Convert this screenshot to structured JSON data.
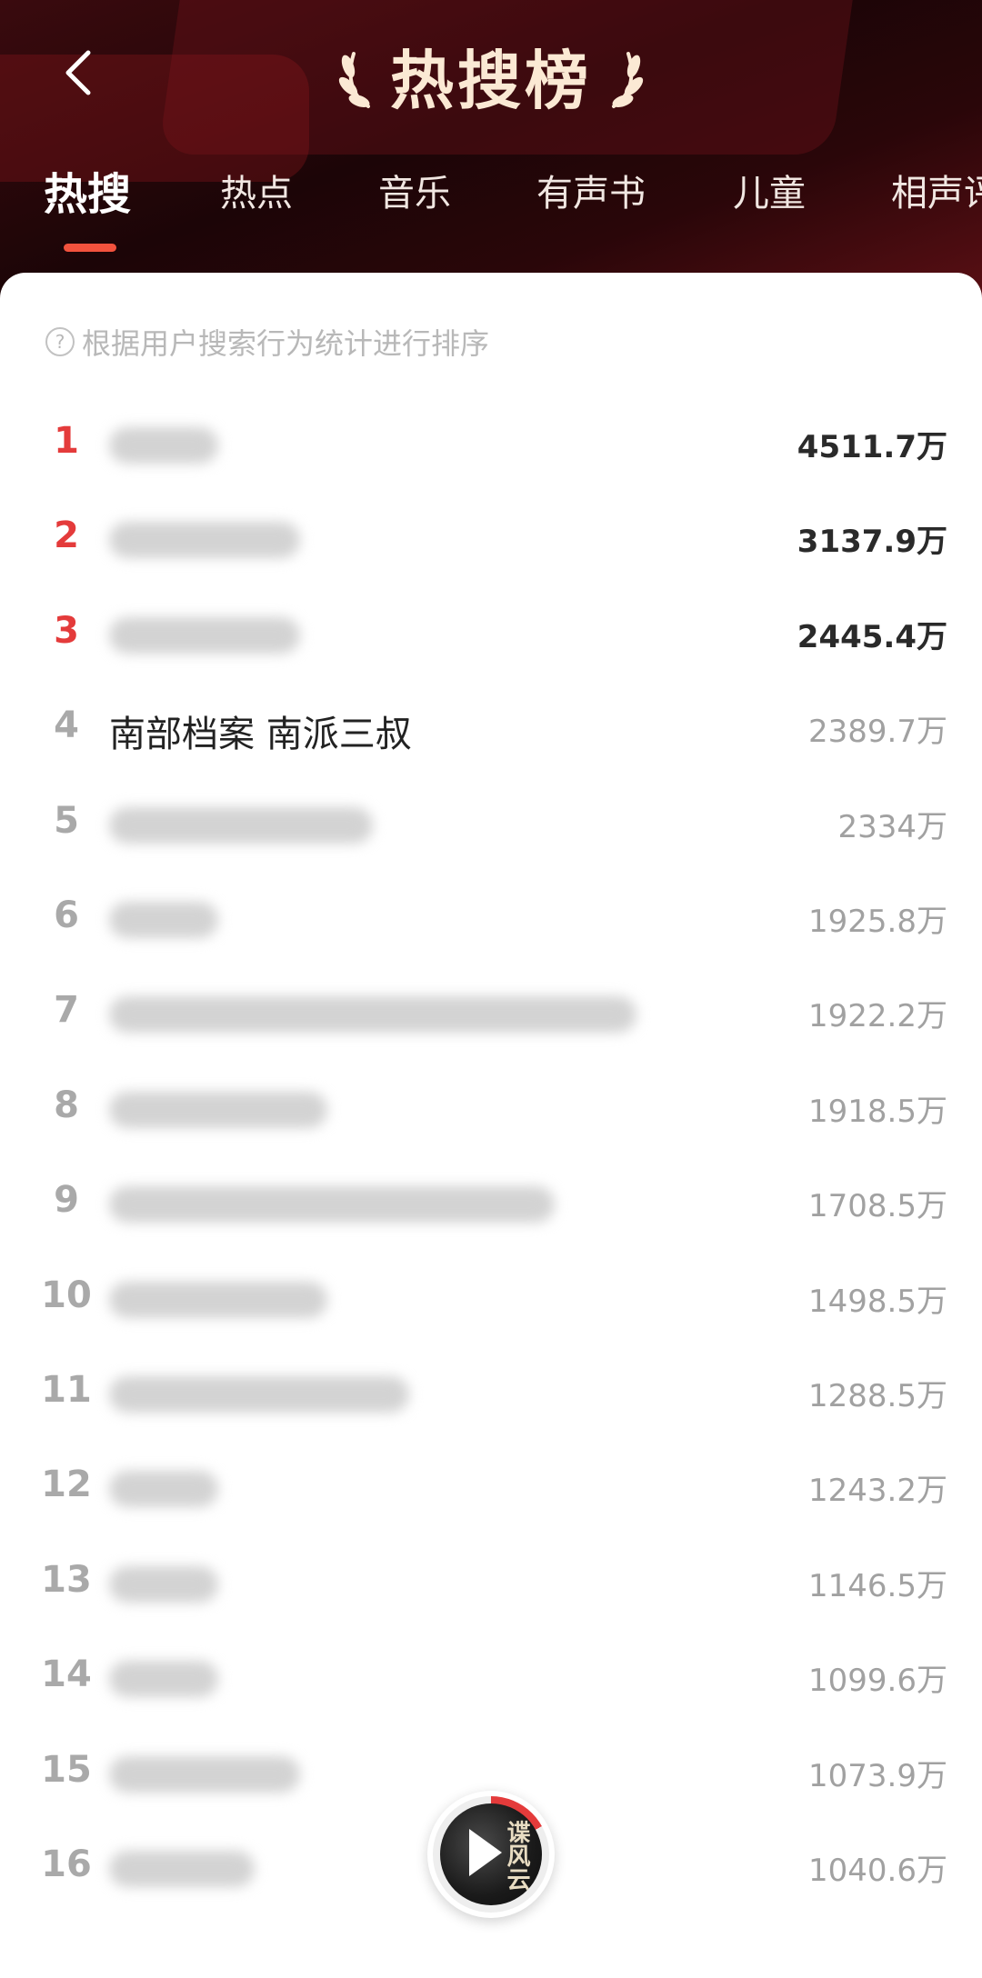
{
  "header": {
    "title": "热搜榜",
    "back_icon": "chevron-left-icon",
    "laurel_icons": [
      "laurel-left-icon",
      "laurel-right-icon"
    ]
  },
  "tabs": [
    {
      "label": "热搜",
      "active": true
    },
    {
      "label": "热点",
      "active": false
    },
    {
      "label": "音乐",
      "active": false
    },
    {
      "label": "有声书",
      "active": false
    },
    {
      "label": "儿童",
      "active": false
    },
    {
      "label": "相声评",
      "active": false
    }
  ],
  "hint": {
    "text": "根据用户搜索行为统计进行排序",
    "icon": "question-circle-icon"
  },
  "colors": {
    "accent": "#e43b3b",
    "tab_underline": "#f2523d",
    "title": "#fbe9d4"
  },
  "rankings": [
    {
      "rank": "1",
      "name": "",
      "value": "4511.7万"
    },
    {
      "rank": "2",
      "name": "",
      "value": "3137.9万"
    },
    {
      "rank": "3",
      "name": "",
      "value": "2445.4万"
    },
    {
      "rank": "4",
      "name": "南部档案 南派三叔",
      "value": "2389.7万"
    },
    {
      "rank": "5",
      "name": "",
      "value": "2334万"
    },
    {
      "rank": "6",
      "name": "",
      "value": "1925.8万"
    },
    {
      "rank": "7",
      "name": "",
      "value": "1922.2万"
    },
    {
      "rank": "8",
      "name": "",
      "value": "1918.5万"
    },
    {
      "rank": "9",
      "name": "",
      "value": "1708.5万"
    },
    {
      "rank": "10",
      "name": "",
      "value": "1498.5万"
    },
    {
      "rank": "11",
      "name": "",
      "value": "1288.5万"
    },
    {
      "rank": "12",
      "name": "",
      "value": "1243.2万"
    },
    {
      "rank": "13",
      "name": "",
      "value": "1146.5万"
    },
    {
      "rank": "14",
      "name": "",
      "value": "1099.6万"
    },
    {
      "rank": "15",
      "name": "",
      "value": "1073.9万"
    },
    {
      "rank": "16",
      "name": "",
      "value": "1040.6万"
    }
  ],
  "player": {
    "cover_text": "谍风云",
    "play_icon": "play-icon",
    "progress": 0.17
  }
}
